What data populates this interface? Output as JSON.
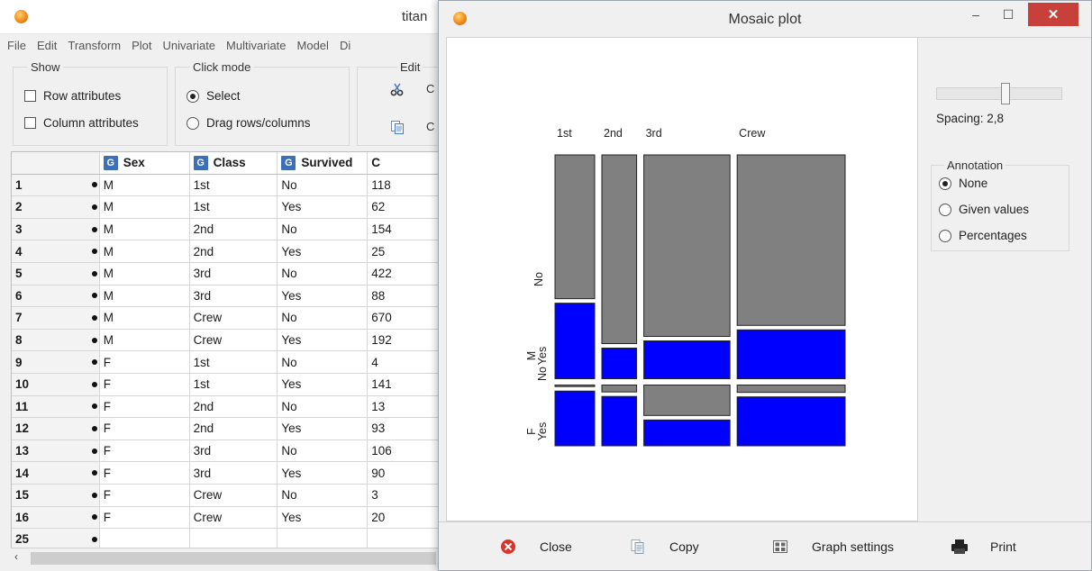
{
  "main_window": {
    "title": "titan",
    "menu": [
      "File",
      "Edit",
      "Transform",
      "Plot",
      "Univariate",
      "Multivariate",
      "Model",
      "Di"
    ],
    "show_group": {
      "title": "Show",
      "row_attributes": "Row attributes",
      "column_attributes": "Column attributes"
    },
    "click_mode_group": {
      "title": "Click mode",
      "select": "Select",
      "drag": "Drag rows/columns"
    },
    "edit_group": {
      "title": "Edit",
      "cut_letter": "C",
      "copy_letter": "C"
    },
    "grid": {
      "badge": "G",
      "headers": {
        "sex": "Sex",
        "class": "Class",
        "survived": "Survived",
        "count": "C"
      },
      "rows": [
        {
          "idx": "1",
          "sex": "M",
          "class": "1st",
          "survived": "No",
          "count": "118"
        },
        {
          "idx": "2",
          "sex": "M",
          "class": "1st",
          "survived": "Yes",
          "count": "62"
        },
        {
          "idx": "3",
          "sex": "M",
          "class": "2nd",
          "survived": "No",
          "count": "154"
        },
        {
          "idx": "4",
          "sex": "M",
          "class": "2nd",
          "survived": "Yes",
          "count": "25"
        },
        {
          "idx": "5",
          "sex": "M",
          "class": "3rd",
          "survived": "No",
          "count": "422"
        },
        {
          "idx": "6",
          "sex": "M",
          "class": "3rd",
          "survived": "Yes",
          "count": "88"
        },
        {
          "idx": "7",
          "sex": "M",
          "class": "Crew",
          "survived": "No",
          "count": "670"
        },
        {
          "idx": "8",
          "sex": "M",
          "class": "Crew",
          "survived": "Yes",
          "count": "192"
        },
        {
          "idx": "9",
          "sex": "F",
          "class": "1st",
          "survived": "No",
          "count": "4"
        },
        {
          "idx": "10",
          "sex": "F",
          "class": "1st",
          "survived": "Yes",
          "count": "141"
        },
        {
          "idx": "11",
          "sex": "F",
          "class": "2nd",
          "survived": "No",
          "count": "13"
        },
        {
          "idx": "12",
          "sex": "F",
          "class": "2nd",
          "survived": "Yes",
          "count": "93"
        },
        {
          "idx": "13",
          "sex": "F",
          "class": "3rd",
          "survived": "No",
          "count": "106"
        },
        {
          "idx": "14",
          "sex": "F",
          "class": "3rd",
          "survived": "Yes",
          "count": "90"
        },
        {
          "idx": "15",
          "sex": "F",
          "class": "Crew",
          "survived": "No",
          "count": "3"
        },
        {
          "idx": "16",
          "sex": "F",
          "class": "Crew",
          "survived": "Yes",
          "count": "20"
        },
        {
          "idx": "25",
          "sex": "",
          "class": "",
          "survived": "",
          "count": ""
        }
      ]
    }
  },
  "plot_window": {
    "title": "Mosaic plot",
    "mosaic": {
      "class_labels": [
        "1st",
        "2nd",
        "3rd",
        "Crew"
      ],
      "sex_labels": [
        "M",
        "F"
      ],
      "survived_labels": [
        "No",
        "Yes"
      ],
      "colors": {
        "no": "#808080",
        "yes": "#0000ff"
      }
    },
    "spacing_label": "Spacing: 2,8",
    "annotation": {
      "title": "Annotation",
      "none": "None",
      "given_values": "Given values",
      "percentages": "Percentages"
    },
    "buttons": {
      "close": "Close",
      "copy": "Copy",
      "graph_settings": "Graph settings",
      "print": "Print"
    },
    "titlebar": {
      "minimize": "–",
      "maximize": "☐",
      "close": "✕"
    }
  }
}
